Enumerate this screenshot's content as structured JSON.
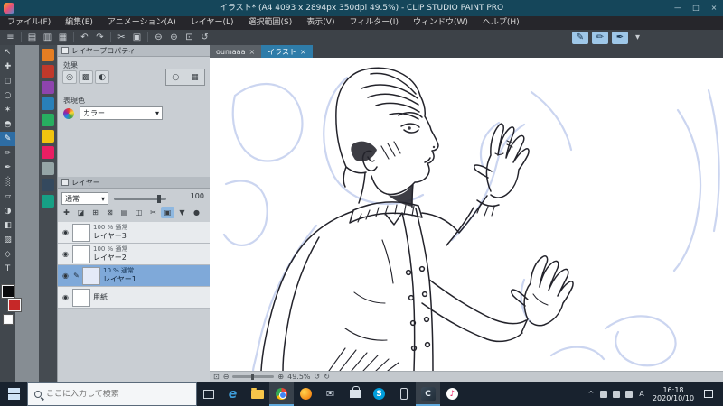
{
  "title_bar": {
    "title": "イラスト* (A4 4093 x 2894px 350dpi 49.5%) - CLIP STUDIO PAINT PRO"
  },
  "menu": {
    "items": [
      "ファイル(F)",
      "編集(E)",
      "アニメーション(A)",
      "レイヤー(L)",
      "選択範囲(S)",
      "表示(V)",
      "フィルター(I)",
      "ウィンドウ(W)",
      "ヘルプ(H)"
    ]
  },
  "tabs": {
    "tab1": "oumaaa",
    "tab2": "イラスト"
  },
  "layer_property": {
    "title": "レイヤープロパティ",
    "effect_label": "効果",
    "color_label": "表現色",
    "color_value": "カラー"
  },
  "layer_panel": {
    "title": "レイヤー",
    "blend_mode": "通常",
    "opacity": "100",
    "layers": [
      {
        "info": "100 % 通常",
        "name": "レイヤー3"
      },
      {
        "info": "100 % 通常",
        "name": "レイヤー2"
      },
      {
        "info": "10 % 通常",
        "name": "レイヤー1"
      },
      {
        "info": "",
        "name": "用紙"
      }
    ]
  },
  "canvas_status": {
    "zoom": "49.5%"
  },
  "taskbar": {
    "search_placeholder": "ここに入力して検索",
    "time": "16:18",
    "date": "2020/10/10"
  },
  "colors": {
    "accent": "#2e7ca9",
    "selection": "#7fa9d9",
    "sketch_blue": "#a9b9e6",
    "ink": "#23232b"
  },
  "icons": {
    "hamburger": "≡",
    "win_min": "—",
    "win_max": "□",
    "win_close": "×",
    "close": "×",
    "dropdown": "▾",
    "toolbar": [
      "▤",
      "▥",
      "▦",
      "↶",
      "↷",
      "✂",
      "▣",
      "⊖",
      "⊕",
      "⊡",
      "↺"
    ],
    "active_tools": [
      "✎",
      "✏",
      "✒"
    ],
    "tools": [
      "↖",
      "✚",
      "◻",
      "○",
      "✶",
      "◓",
      "✎",
      "✏",
      "✒",
      "░",
      "▱",
      "◑",
      "◧",
      "▨",
      "◇",
      "T"
    ],
    "effects": [
      "◎",
      "▩",
      "◐"
    ],
    "effect_box": [
      "○",
      "▦"
    ],
    "layer_cmds": [
      "✚",
      "◪",
      "⊞",
      "⊠",
      "▤",
      "◫",
      "✂",
      "▣",
      "▼",
      "●"
    ],
    "eye": "◉",
    "edit": "✎",
    "status": [
      "⊡",
      "⊖",
      "⊕",
      "↺",
      "↻"
    ],
    "tray_chevron": "^",
    "ime": "A",
    "edge": "e",
    "skype": "S",
    "csp": "C",
    "music": "♪",
    "mail": "✉"
  }
}
